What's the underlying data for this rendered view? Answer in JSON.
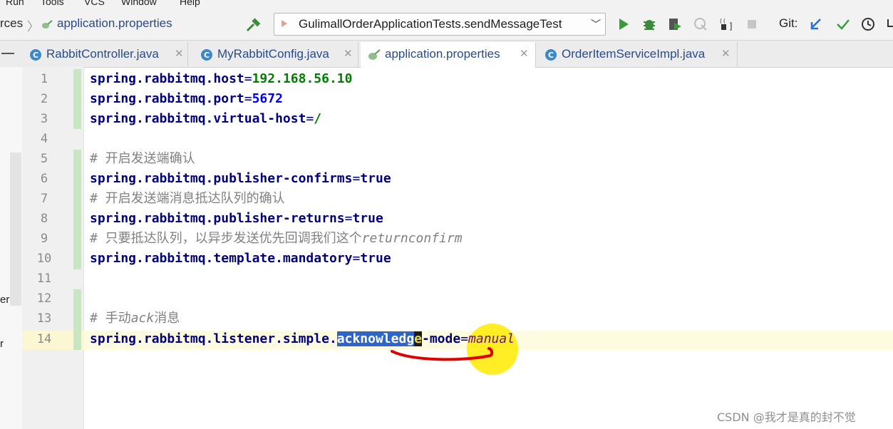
{
  "menubar": {
    "items": [
      "Run",
      "Tools",
      "VCS",
      "Window",
      "Help"
    ]
  },
  "navbar": {
    "breadcrumb": [
      "rces",
      "application.properties"
    ],
    "run_config": "GulimallOrderApplicationTests.sendMessageTest",
    "git_label": "Git:"
  },
  "tabs": [
    {
      "label": "RabbitController.java",
      "active": false
    },
    {
      "label": "MyRabbitConfig.java",
      "active": false
    },
    {
      "label": "application.properties",
      "active": true
    },
    {
      "label": "OrderItemServiceImpl.java",
      "active": false
    }
  ],
  "left_strip": [
    "er",
    "r"
  ],
  "editor": {
    "line_numbers": [
      "1",
      "2",
      "3",
      "4",
      "5",
      "6",
      "7",
      "8",
      "9",
      "10",
      "11",
      "12",
      "13",
      "14"
    ],
    "current_line": "14",
    "lines": {
      "l1": {
        "key": "spring.rabbitmq.host",
        "eq": "=",
        "value": "192.168.56.10"
      },
      "l2": {
        "key": "spring.rabbitmq.port",
        "eq": "=",
        "value": "5672"
      },
      "l3": {
        "key": "spring.rabbitmq.virtual-host",
        "eq": "=",
        "value": "/"
      },
      "l5": {
        "comment": "# 开启发送端确认"
      },
      "l6": {
        "key": "spring.rabbitmq.publisher-confirms",
        "eq": "=",
        "value": "true"
      },
      "l7": {
        "comment": "# 开启发送端消息抵达队列的确认"
      },
      "l8": {
        "key": "spring.rabbitmq.publisher-returns",
        "eq": "=",
        "value": "true"
      },
      "l9": {
        "comment": "# 只要抵达队列，以异步发送优先回调我们这个",
        "comment_italic": "returnconfirm"
      },
      "l10": {
        "key": "spring.rabbitmq.template.mandatory",
        "eq": "=",
        "value": "true"
      },
      "l13": {
        "comment": "# 手动",
        "comment_italic": "ack",
        "comment_tail": "消息"
      },
      "l14": {
        "key_prefix": "spring.rabbitmq.listener.simple.",
        "key_selected": "acknowledg",
        "key_caret": "e",
        "key_suffix": "-mode",
        "eq": "=",
        "value": "manual"
      }
    }
  },
  "watermark": "CSDN @我才是真的封不觉",
  "colors": {
    "key": "#000080",
    "number": "#0000ff",
    "ip": "#008000",
    "italic_value": "#660e7a",
    "comment": "#808080",
    "selection": "#2f65ca",
    "cursor_halo": "#ffeb00",
    "annotation_red": "#e00000"
  }
}
